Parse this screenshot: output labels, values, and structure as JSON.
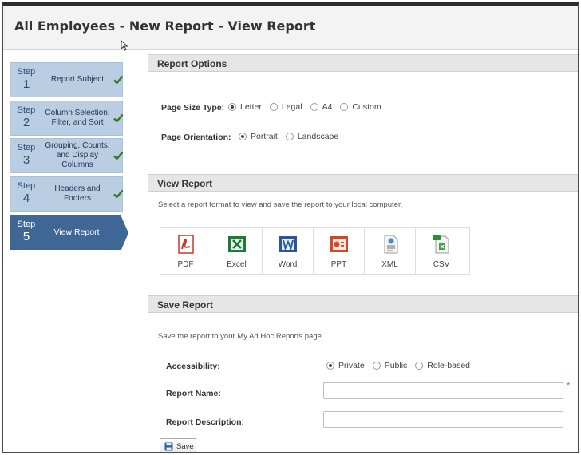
{
  "page": {
    "title": "All Employees - New Report - View Report"
  },
  "steps": [
    {
      "word": "Step",
      "num": "1",
      "label": "Report Subject",
      "done": true
    },
    {
      "word": "Step",
      "num": "2",
      "label": "Column Selection, Filter, and Sort",
      "done": true
    },
    {
      "word": "Step",
      "num": "3",
      "label": "Grouping, Counts, and Display Columns",
      "done": true
    },
    {
      "word": "Step",
      "num": "4",
      "label": "Headers and Footers",
      "done": true
    },
    {
      "word": "Step",
      "num": "5",
      "label": "View Report",
      "done": false
    }
  ],
  "report_options": {
    "heading": "Report Options",
    "page_size_label": "Page Size Type:",
    "page_sizes": [
      "Letter",
      "Legal",
      "A4",
      "Custom"
    ],
    "page_size_selected": "Letter",
    "orientation_label": "Page Orientation:",
    "orientations": [
      "Portrait",
      "Landscape"
    ],
    "orientation_selected": "Portrait"
  },
  "view_report": {
    "heading": "View Report",
    "hint": "Select a report format to view and save the report to your local computer.",
    "formats": [
      {
        "label": "PDF",
        "icon": "pdf-icon"
      },
      {
        "label": "Excel",
        "icon": "excel-icon"
      },
      {
        "label": "Word",
        "icon": "word-icon"
      },
      {
        "label": "PPT",
        "icon": "ppt-icon"
      },
      {
        "label": "XML",
        "icon": "xml-icon"
      },
      {
        "label": "CSV",
        "icon": "csv-icon"
      }
    ]
  },
  "save_report": {
    "heading": "Save Report",
    "hint": "Save the report to your My Ad Hoc Reports page.",
    "accessibility_label": "Accessibility:",
    "accessibility_options": [
      "Private",
      "Public",
      "Role-based"
    ],
    "accessibility_selected": "Private",
    "name_label": "Report Name:",
    "name_value": "",
    "required_mark": "*",
    "description_label": "Report Description:",
    "description_value": "",
    "save_label": "Save"
  },
  "colors": {
    "accent": "#3f6795",
    "step_bg": "#b9cde3",
    "check": "#2e7d1e",
    "required": "#d9534f"
  }
}
